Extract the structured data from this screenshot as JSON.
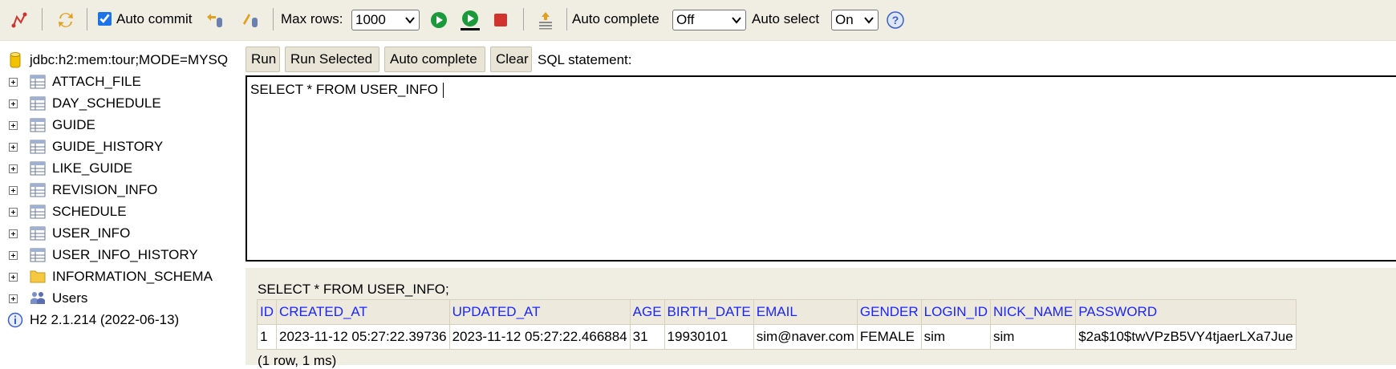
{
  "toolbar": {
    "auto_commit_label": "Auto commit",
    "auto_commit_checked": true,
    "max_rows_label": "Max rows:",
    "max_rows_value": "1000",
    "auto_complete_label": "Auto complete",
    "auto_complete_value": "Off",
    "auto_select_label": "Auto select",
    "auto_select_value": "On",
    "icons": [
      "disconnect-icon",
      "refresh-icon",
      "rollback-icon",
      "commit-icon",
      "run-icon",
      "run-selected-icon",
      "stop-icon",
      "history-icon",
      "help-icon"
    ]
  },
  "sidebar": {
    "connection": "jdbc:h2:mem:tour;MODE=MYSQ",
    "tables": [
      {
        "label": "ATTACH_FILE"
      },
      {
        "label": "DAY_SCHEDULE"
      },
      {
        "label": "GUIDE"
      },
      {
        "label": "GUIDE_HISTORY"
      },
      {
        "label": "LIKE_GUIDE"
      },
      {
        "label": "REVISION_INFO"
      },
      {
        "label": "SCHEDULE"
      },
      {
        "label": "USER_INFO"
      },
      {
        "label": "USER_INFO_HISTORY"
      }
    ],
    "schema": "INFORMATION_SCHEMA",
    "users": "Users",
    "version": "H2 2.1.214 (2022-06-13)"
  },
  "actions": {
    "run": "Run",
    "run_selected": "Run Selected",
    "auto_complete": "Auto complete",
    "clear": "Clear",
    "sql_statement": "SQL statement:"
  },
  "editor": {
    "text": "SELECT * FROM USER_INFO"
  },
  "result": {
    "query": "SELECT * FROM USER_INFO;",
    "columns": [
      "ID",
      "CREATED_AT",
      "UPDATED_AT",
      "AGE",
      "BIRTH_DATE",
      "EMAIL",
      "GENDER",
      "LOGIN_ID",
      "NICK_NAME",
      "PASSWORD"
    ],
    "rows": [
      [
        "1",
        "2023-11-12 05:27:22.39736",
        "2023-11-12 05:27:22.466884",
        "31",
        "19930101",
        "sim@naver.com",
        "FEMALE",
        "sim",
        "sim",
        "$2a$10$twVPzB5VY4tjaerLXa7Jue"
      ]
    ],
    "row_count": "(1 row, 1 ms)"
  },
  "colors": {
    "toolbar_bg": "#f0ede3",
    "header_text": "#1a25ff",
    "button_bg": "#e8e4d6"
  }
}
